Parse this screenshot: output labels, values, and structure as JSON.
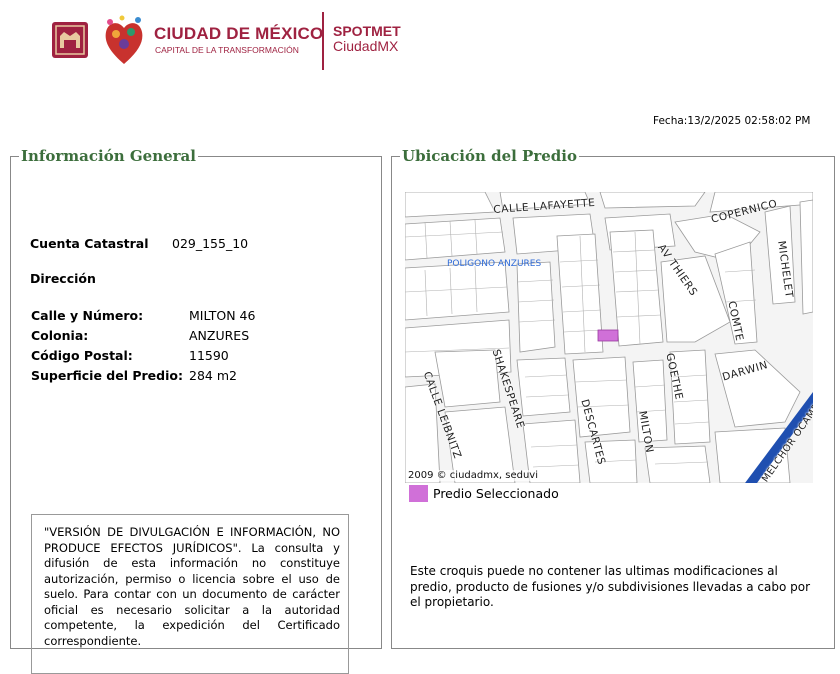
{
  "header": {
    "gov_title": "CIUDAD DE MÉXICO",
    "gov_subtitle": "CAPITAL DE LA TRANSFORMACIÓN",
    "app_name_line1": "SPOTMET",
    "app_name_line2": "CiudadMX",
    "brand_color": "#9f2241"
  },
  "fecha": "Fecha:13/2/2025 02:58:02 PM",
  "info_general": {
    "legend": "Información General",
    "cuenta_label": "Cuenta Catastral",
    "cuenta_value": "029_155_10",
    "direccion_label": "Dirección",
    "rows": [
      {
        "label": "Calle y Número:",
        "value": "MILTON 46"
      },
      {
        "label": "Colonia:",
        "value": "ANZURES"
      },
      {
        "label": "Código Postal:",
        "value": "11590"
      },
      {
        "label": "Superficie del Predio:",
        "value": "284 m2"
      }
    ],
    "disclaimer": "\"VERSIÓN DE DIVULGACIÓN E INFORMACIÓN, NO PRODUCE EFECTOS JURÍDICOS\". La consulta y difusión de esta información no constituye autorización, permiso o licencia sobre el uso de suelo. Para contar con un documento de carácter oficial es necesario solicitar a la autoridad competente, la expedición del Certificado correspondiente."
  },
  "ubicacion": {
    "legend": "Ubicación del Predio",
    "map": {
      "streets": [
        "CALLE LAFAYETTE",
        "COPERNICO",
        "MICHELET",
        "AV THIERS",
        "COMTE",
        "DARWIN",
        "SHAKESPEARE",
        "CALLE LEIBNITZ",
        "DESCARTES",
        "MILTON",
        "GOETHE",
        "MELCHOR OCAMPO"
      ],
      "polygon_label": "POLIGONO ANZURES",
      "copyright": "2009 © ciudadmx, seduvi",
      "selected_color": "#d070d8"
    },
    "legend_item": "Predio Seleccionado",
    "note": "Este croquis puede no contener las ultimas modificaciones al predio, producto de fusiones y/o subdivisiones llevadas a cabo por el propietario."
  }
}
